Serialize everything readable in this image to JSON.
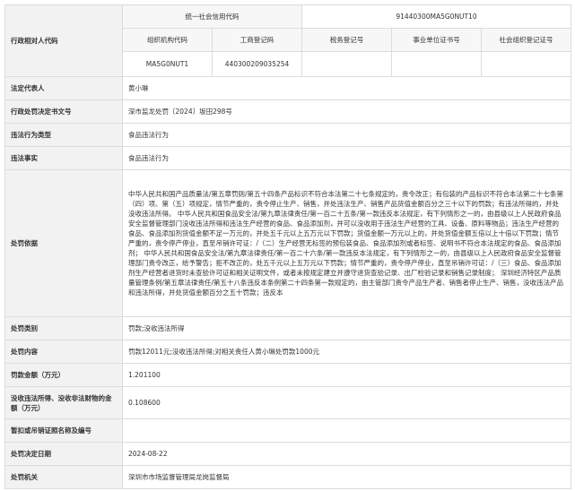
{
  "subject_code": {
    "label": "行政相对人代码",
    "uscc_label": "统一社会信用代码",
    "uscc_value": "91440300MA5G0NUT10",
    "org_code_label": "组织机构代码",
    "business_reg_label": "工商登记码",
    "tax_reg_label": "税务登记号",
    "institution_cert_label": "事业单位证书号",
    "social_org_label": "社会组织登记证号",
    "org_code_value": "MA5G0NUT1",
    "business_reg_value": "440300209035254",
    "tax_reg_value": "",
    "institution_cert_value": "",
    "social_org_value": ""
  },
  "rows": {
    "legal_rep": {
      "label": "法定代表人",
      "value": "黄小琳"
    },
    "decision_no": {
      "label": "行政处罚决定书文号",
      "value": "深市监龙处罚〔2024〕坂田298号"
    },
    "violation_type": {
      "label": "违法行为类型",
      "value": "食品违法行为"
    },
    "violation_fact": {
      "label": "违法事实",
      "value": "食品违法行为"
    },
    "basis": {
      "label": "处罚依据",
      "value": "中华人民共和国产品质量法/第五章罚则/第五十四条产品标识不符合本法第二十七条规定的，责令改正；有包装的产品标识不符合本法第二十七条第（四）项、第（五）项规定，情节严重的，责令停止生产、销售，并处违法生产、销售产品货值金额百分之三十以下的罚款；有违法所得的，并处没收违法所得。 中华人民共和国食品安全法/第九章法律责任/第一百二十五条/第一款违反本法规定，有下列情形之一的，由县级以上人民政府食品安全监督管理部门没收违法所得和违法生产经营的食品、食品添加剂，并可以没收用于违法生产经营的工具、设备、原料等物品；违法生产经营的食品、食品添加剂货值金额不足一万元的，并处五千元以上五万元以下罚款；货值金额一万元以上的，并处货值金额五倍以上十倍以下罚款；情节严重的，责令停产停业，直至吊销许可证：/（二）生产经营无标签的预包装食品、食品添加剂或者标签、说明书不符合本法规定的食品、食品添加剂； 中华人民共和国食品安全法/第九章法律责任/第一百二十六条/第一款违反本法规定，有下列情形之一的，由县级以上人民政府食品安全监督管理部门责令改正，给予警告；拒不改正的，处五千元以上五万元以下罚款；情节严重的，责令停产停业，直至吊销许可证：/（三）食品、食品添加剂生产经营者进货时未查验许可证和相关证明文件，或者未按规定建立并遵守进货查验记录、出厂检验记录和销售记录制度； 深圳经济特区产品质量管理条例/第五章法律责任/第五十八条违反本条例第二十四条第一款规定的，由主管部门责令产品生产者、销售者停止生产、销售，没收违法产品和违法所得，并处货值金额百分之五十罚款；违反本"
    },
    "category": {
      "label": "处罚类别",
      "value": "罚款;没收违法所得"
    },
    "content": {
      "label": "处罚内容",
      "value": "罚款12011元;没收违法所得;对相关责任人黄小琳处罚款1000元"
    },
    "fine": {
      "label": "罚款金额（万元）",
      "value": "1.201100"
    },
    "confiscated": {
      "label": "没收违法所得、没收非法财物的金额（万元）",
      "value": "0.108600"
    },
    "suspended": {
      "label": "暂扣或吊销证照名称及编号",
      "value": ""
    },
    "decision_date": {
      "label": "处罚决定日期",
      "value": "2024-08-22"
    },
    "authority": {
      "label": "处罚机关",
      "value": "深圳市市场监督管理局龙岗监督局"
    }
  }
}
